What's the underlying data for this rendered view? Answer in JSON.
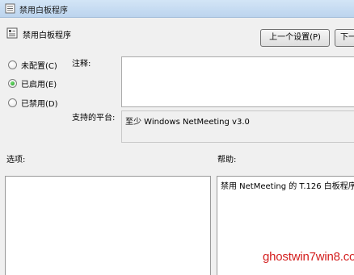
{
  "window": {
    "title": "禁用白板程序"
  },
  "header": {
    "title": "禁用白板程序"
  },
  "buttons": {
    "prev": "上一个设置(P)",
    "next": "下一"
  },
  "state_options": [
    {
      "label": "未配置(C)",
      "checked": false
    },
    {
      "label": "已启用(E)",
      "checked": true
    },
    {
      "label": "已禁用(D)",
      "checked": false
    }
  ],
  "labels": {
    "comment": "注释:",
    "platform": "支持的平台:",
    "options": "选项:",
    "help": "帮助:"
  },
  "platform_value": "至少 Windows NetMeeting v3.0",
  "help_text": "禁用 NetMeeting 的 T.126 白板程序",
  "watermark": "ghostwin7win8.com"
}
